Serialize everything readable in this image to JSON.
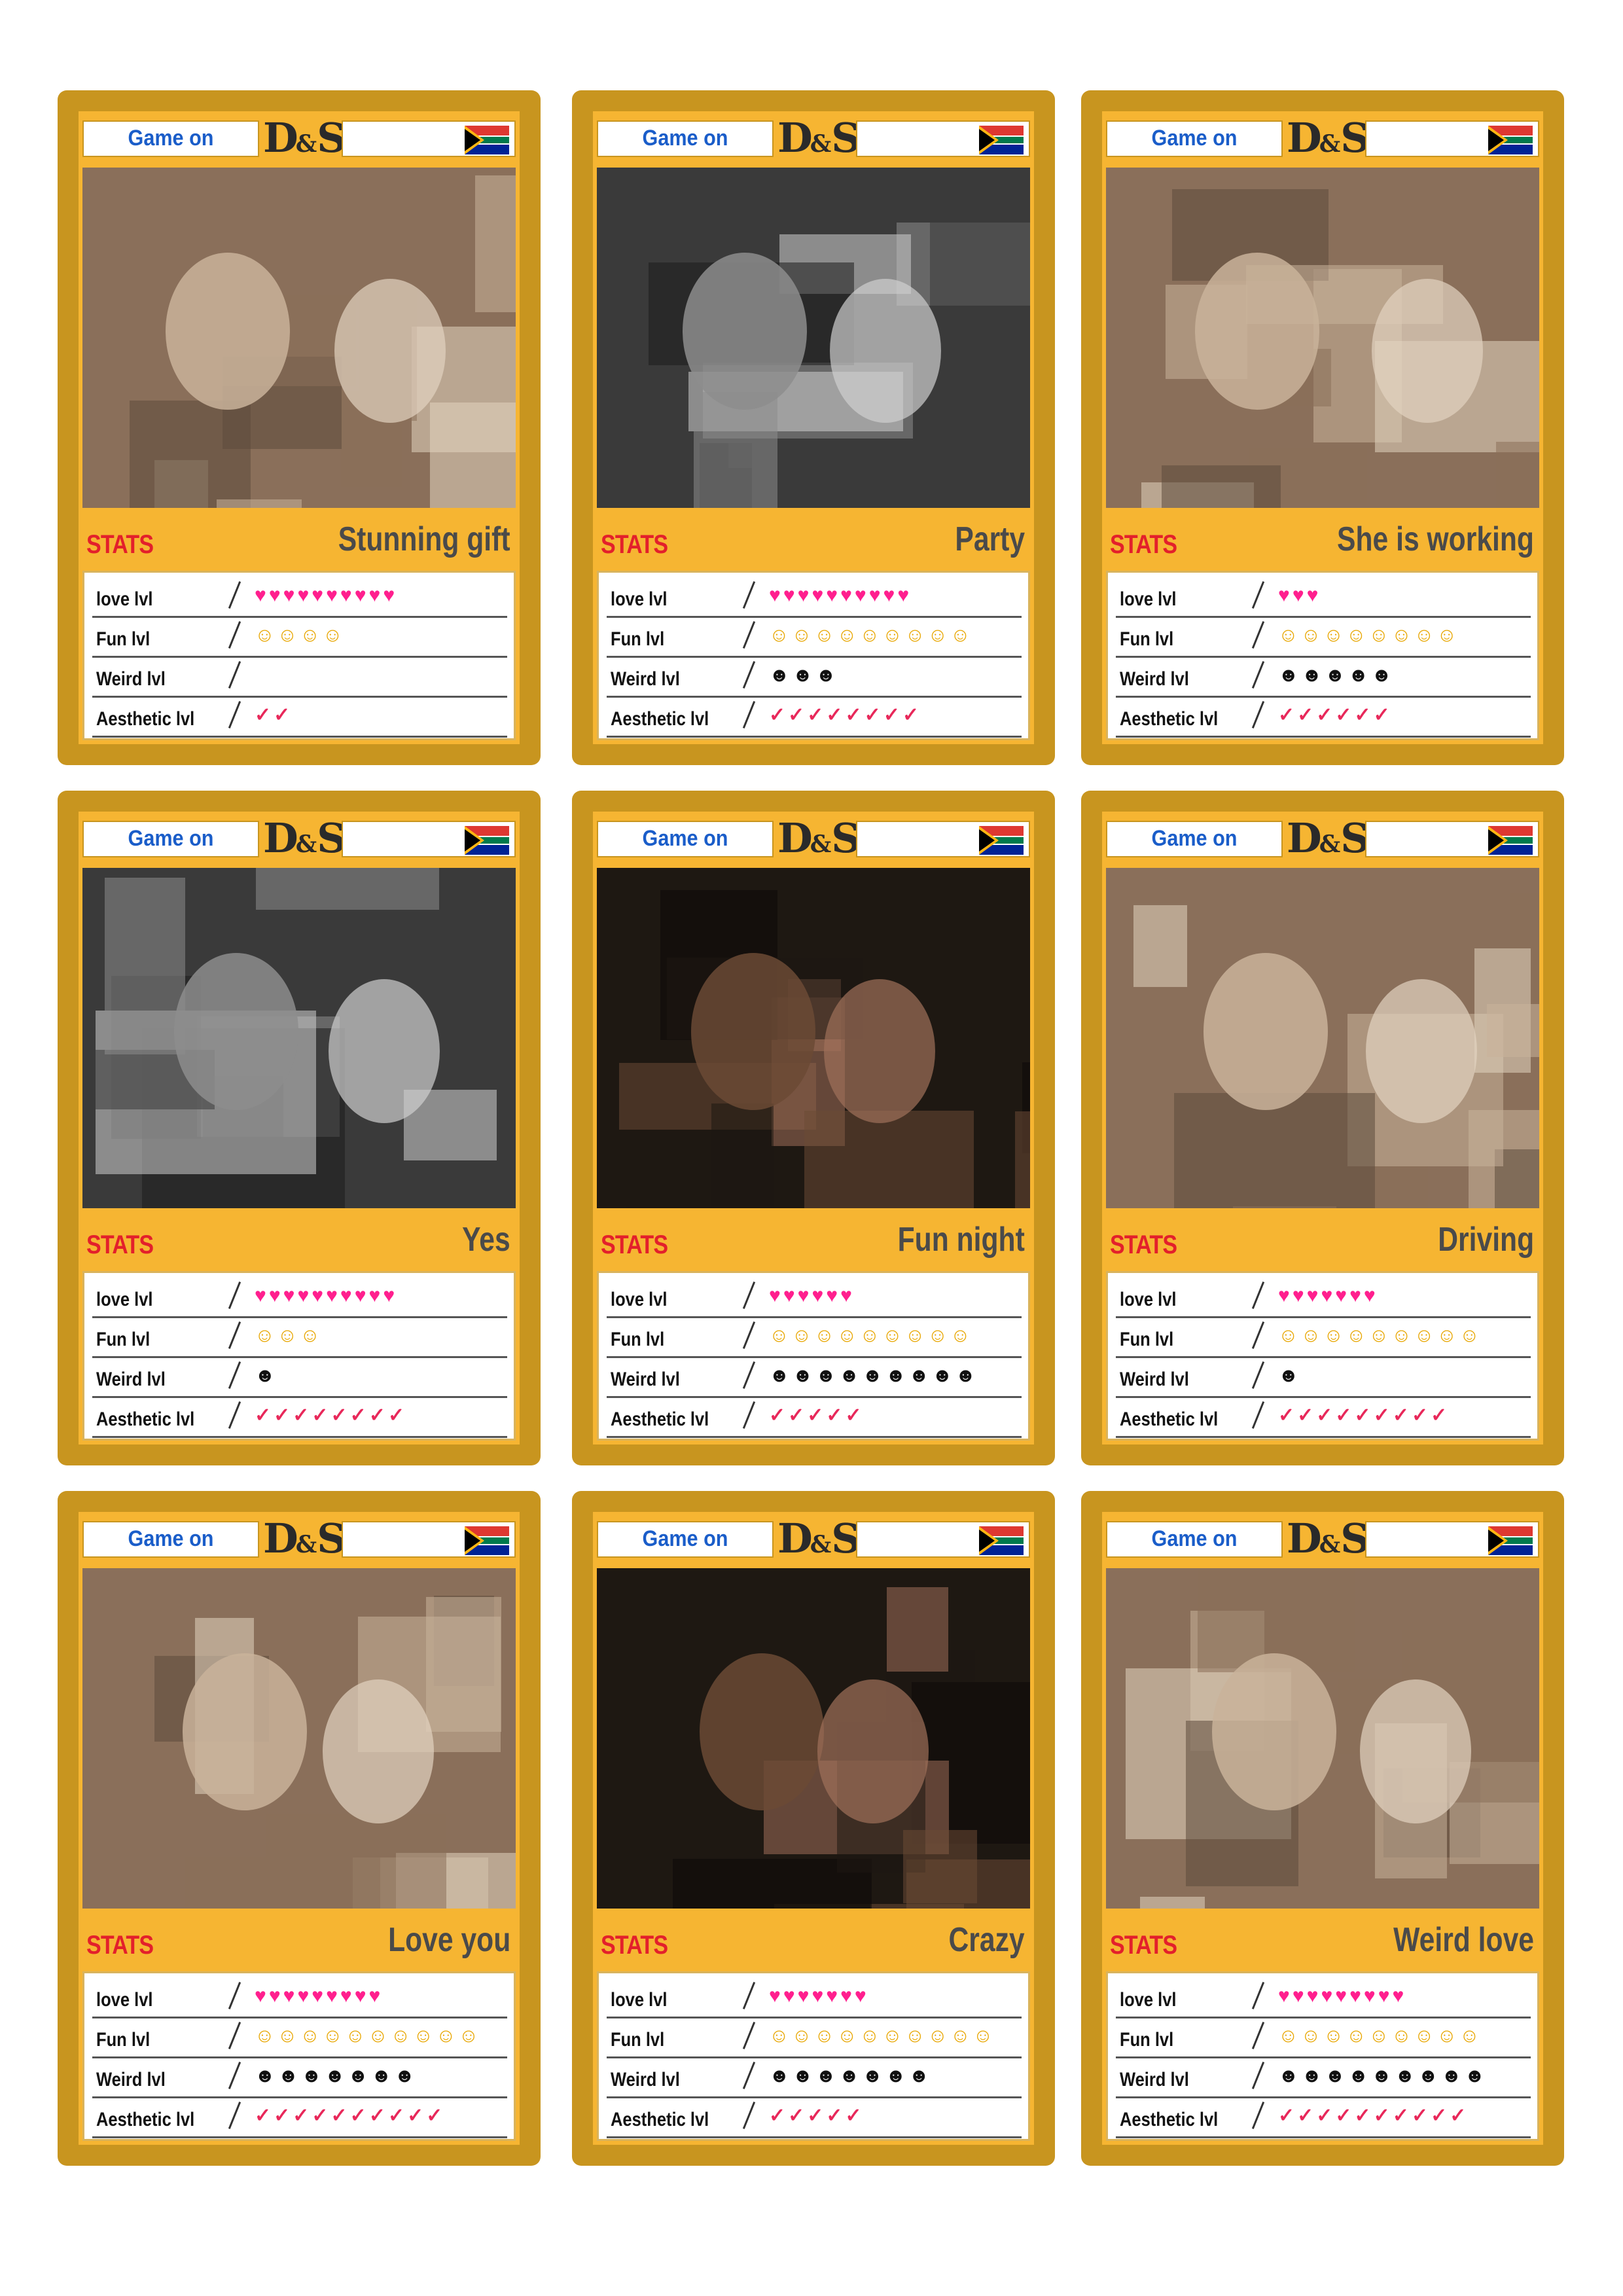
{
  "header": {
    "game_label": "Game on",
    "logo_left": "D",
    "logo_amp": "&",
    "logo_right": "S"
  },
  "stats_label": "STATS",
  "stat_labels": {
    "love": "love lvl",
    "fun": "Fun lvl",
    "weird": "Weird lvl",
    "aesthetic": "Aesthetic lvl"
  },
  "icons": {
    "love": "heart-icon",
    "fun": "laughing-face-icon",
    "weird": "weird-face-icon",
    "aesthetic": "check-icon"
  },
  "colors": {
    "card_border": "#c8951f",
    "card_fill": "#f6b532",
    "stats_red": "#e3202b",
    "title_gray": "#4a4a4a",
    "heart_pink": "#ff1f8e",
    "tick_red": "#e8285a",
    "game_blue": "#1a5dc9"
  },
  "cards": [
    {
      "title": "Stunning gift",
      "love": 10,
      "fun": 4,
      "weird": 0,
      "aesthetic": 2,
      "photo_tone": "color"
    },
    {
      "title": "Party",
      "love": 10,
      "fun": 9,
      "weird": 3,
      "aesthetic": 8,
      "photo_tone": "bw"
    },
    {
      "title": "She is working",
      "love": 3,
      "fun": 8,
      "weird": 5,
      "aesthetic": 6,
      "photo_tone": "color"
    },
    {
      "title": "Yes",
      "love": 10,
      "fun": 3,
      "weird": 1,
      "aesthetic": 8,
      "photo_tone": "bw"
    },
    {
      "title": "Fun night",
      "love": 6,
      "fun": 9,
      "weird": 9,
      "aesthetic": 5,
      "photo_tone": "night"
    },
    {
      "title": "Driving",
      "love": 7,
      "fun": 9,
      "weird": 1,
      "aesthetic": 9,
      "photo_tone": "color"
    },
    {
      "title": "Love you",
      "love": 9,
      "fun": 10,
      "weird": 7,
      "aesthetic": 10,
      "photo_tone": "color"
    },
    {
      "title": "Crazy",
      "love": 7,
      "fun": 10,
      "weird": 7,
      "aesthetic": 5,
      "photo_tone": "night"
    },
    {
      "title": "Weird love",
      "love": 9,
      "fun": 9,
      "weird": 9,
      "aesthetic": 10,
      "photo_tone": "color"
    }
  ]
}
